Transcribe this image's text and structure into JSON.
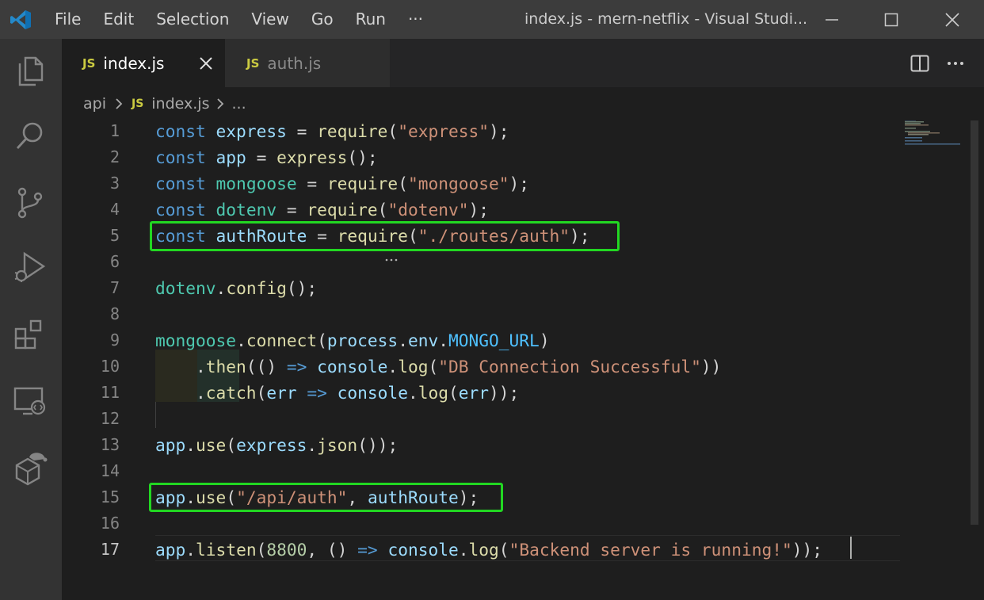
{
  "titlebar": {
    "menu": [
      "File",
      "Edit",
      "Selection",
      "View",
      "Go",
      "Run",
      "···"
    ],
    "window_title": "index.js - mern-netflix - Visual Studi..."
  },
  "activity_bar": {
    "icons": [
      "explorer-icon",
      "search-icon",
      "source-control-icon",
      "run-debug-icon",
      "extensions-icon",
      "remote-explorer-icon",
      "docker-icon"
    ]
  },
  "tabs": [
    {
      "badge": "JS",
      "label": "index.js",
      "active": true
    },
    {
      "badge": "JS",
      "label": "auth.js",
      "active": false
    }
  ],
  "breadcrumb": {
    "folder": "api",
    "file_badge": "JS",
    "file": "index.js",
    "ellipsis": "..."
  },
  "line_numbers": [
    "1",
    "2",
    "3",
    "4",
    "5",
    "6",
    "7",
    "8",
    "9",
    "10",
    "11",
    "12",
    "13",
    "14",
    "15",
    "16",
    "17"
  ],
  "current_line": "17",
  "code": [
    [
      {
        "t": "const",
        "c": "kw"
      },
      {
        "t": " "
      },
      {
        "t": "express",
        "c": "var"
      },
      {
        "t": " = "
      },
      {
        "t": "require",
        "c": "fn"
      },
      {
        "t": "("
      },
      {
        "t": "\"express\"",
        "c": "str"
      },
      {
        "t": ");"
      }
    ],
    [
      {
        "t": "const",
        "c": "kw"
      },
      {
        "t": " "
      },
      {
        "t": "app",
        "c": "var"
      },
      {
        "t": " = "
      },
      {
        "t": "express",
        "c": "fn"
      },
      {
        "t": "();"
      }
    ],
    [
      {
        "t": "const",
        "c": "kw"
      },
      {
        "t": " "
      },
      {
        "t": "mongoose",
        "c": "cls"
      },
      {
        "t": " = "
      },
      {
        "t": "require",
        "c": "fn"
      },
      {
        "t": "("
      },
      {
        "t": "\"mongoose\"",
        "c": "str"
      },
      {
        "t": ");"
      }
    ],
    [
      {
        "t": "const",
        "c": "kw"
      },
      {
        "t": " "
      },
      {
        "t": "dotenv",
        "c": "cls"
      },
      {
        "t": " = "
      },
      {
        "t": "require",
        "c": "fn"
      },
      {
        "t": "("
      },
      {
        "t": "\"dotenv\"",
        "c": "str"
      },
      {
        "t": ");"
      }
    ],
    [
      {
        "t": "const",
        "c": "kw"
      },
      {
        "t": " "
      },
      {
        "t": "authRoute",
        "c": "var"
      },
      {
        "t": " = "
      },
      {
        "t": "require",
        "c": "fn"
      },
      {
        "t": "("
      },
      {
        "t": "\"./routes/auth\"",
        "c": "str"
      },
      {
        "t": ");"
      }
    ],
    [],
    [
      {
        "t": "dotenv",
        "c": "cls"
      },
      {
        "t": "."
      },
      {
        "t": "config",
        "c": "fn"
      },
      {
        "t": "();"
      }
    ],
    [],
    [
      {
        "t": "mongoose",
        "c": "cls"
      },
      {
        "t": "."
      },
      {
        "t": "connect",
        "c": "fn"
      },
      {
        "t": "("
      },
      {
        "t": "process",
        "c": "var"
      },
      {
        "t": "."
      },
      {
        "t": "env",
        "c": "var"
      },
      {
        "t": "."
      },
      {
        "t": "MONGO_URL",
        "c": "con"
      },
      {
        "t": ")"
      }
    ],
    [
      {
        "t": "    ."
      },
      {
        "t": "then",
        "c": "fn"
      },
      {
        "t": "(() "
      },
      {
        "t": "=>",
        "c": "kw"
      },
      {
        "t": " "
      },
      {
        "t": "console",
        "c": "var"
      },
      {
        "t": "."
      },
      {
        "t": "log",
        "c": "fn"
      },
      {
        "t": "("
      },
      {
        "t": "\"DB Connection Successful\"",
        "c": "str"
      },
      {
        "t": "))"
      }
    ],
    [
      {
        "t": "    ."
      },
      {
        "t": "catch",
        "c": "fn"
      },
      {
        "t": "("
      },
      {
        "t": "err",
        "c": "var"
      },
      {
        "t": " "
      },
      {
        "t": "=>",
        "c": "kw"
      },
      {
        "t": " "
      },
      {
        "t": "console",
        "c": "var"
      },
      {
        "t": "."
      },
      {
        "t": "log",
        "c": "fn"
      },
      {
        "t": "("
      },
      {
        "t": "err",
        "c": "var"
      },
      {
        "t": "));"
      }
    ],
    [],
    [
      {
        "t": "app",
        "c": "var"
      },
      {
        "t": "."
      },
      {
        "t": "use",
        "c": "fn"
      },
      {
        "t": "("
      },
      {
        "t": "express",
        "c": "var"
      },
      {
        "t": "."
      },
      {
        "t": "json",
        "c": "fn"
      },
      {
        "t": "());"
      }
    ],
    [],
    [
      {
        "t": "app",
        "c": "var"
      },
      {
        "t": "."
      },
      {
        "t": "use",
        "c": "fn"
      },
      {
        "t": "("
      },
      {
        "t": "\"/api/auth\"",
        "c": "str"
      },
      {
        "t": ", "
      },
      {
        "t": "authRoute",
        "c": "var"
      },
      {
        "t": ");"
      }
    ],
    [],
    [
      {
        "t": "app",
        "c": "var"
      },
      {
        "t": "."
      },
      {
        "t": "listen",
        "c": "fn"
      },
      {
        "t": "("
      },
      {
        "t": "8800",
        "c": "num"
      },
      {
        "t": ", () "
      },
      {
        "t": "=>",
        "c": "kw"
      },
      {
        "t": " "
      },
      {
        "t": "console",
        "c": "var"
      },
      {
        "t": "."
      },
      {
        "t": "log",
        "c": "fn"
      },
      {
        "t": "("
      },
      {
        "t": "\"Backend server is running!\"",
        "c": "str"
      },
      {
        "t": "));"
      }
    ]
  ],
  "highlighted_lines": [
    "5",
    "15"
  ],
  "colors": {
    "highlight": "#22d722",
    "keyword": "#569cd6",
    "string": "#ce9178",
    "function": "#dcdcaa",
    "variable": "#9cdcfe",
    "type": "#4ec9b0",
    "js_badge": "#cbcb41"
  }
}
